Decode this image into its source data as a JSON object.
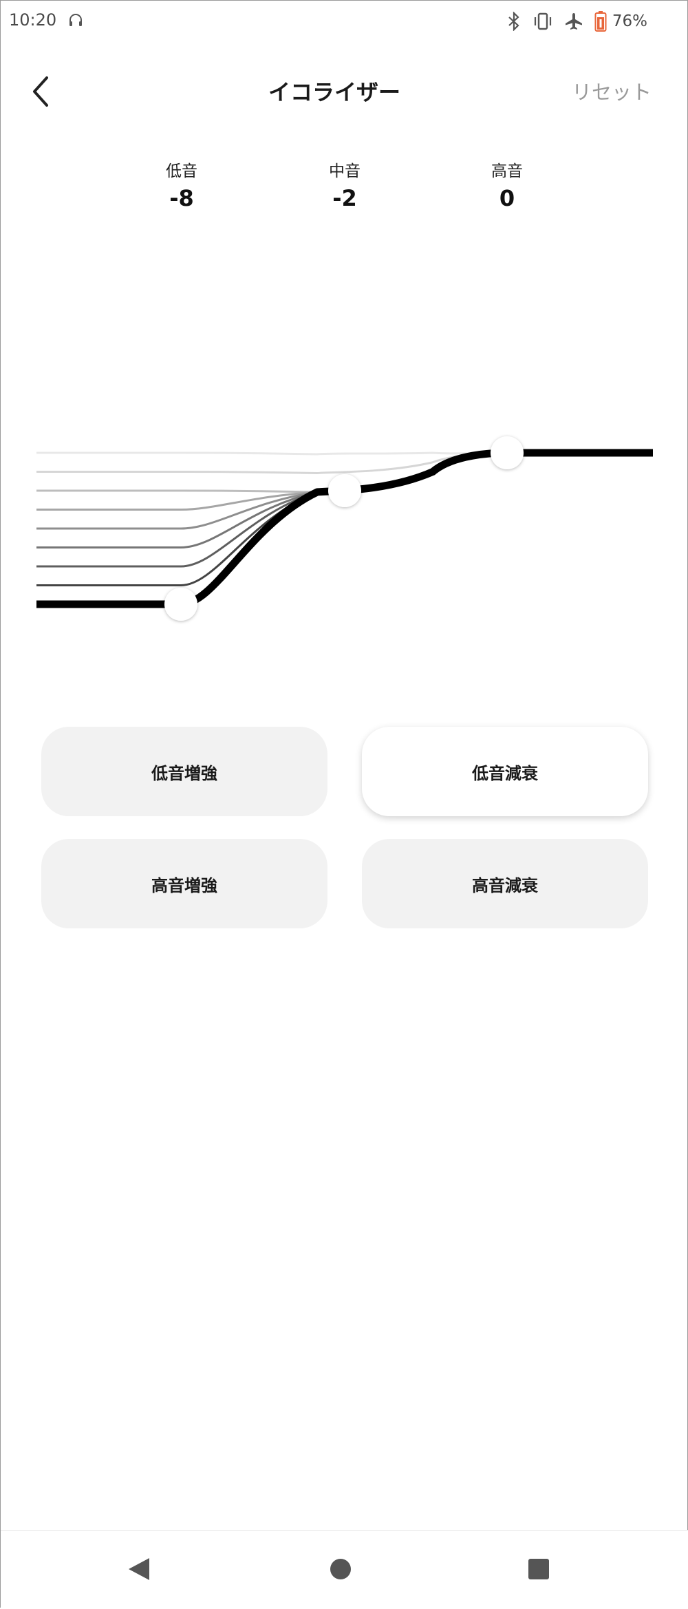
{
  "status_bar": {
    "time": "10:20",
    "battery": "76%",
    "icons": [
      "headphone-icon",
      "bluetooth-icon",
      "vibrate-icon",
      "airplane-icon",
      "battery-icon"
    ],
    "battery_color": "#e8663a"
  },
  "header": {
    "title": "イコライザー",
    "reset_label": "リセット",
    "back_icon": "chevron-left-icon"
  },
  "bands": [
    {
      "label": "低音",
      "value": "-8"
    },
    {
      "label": "中音",
      "value": "-2"
    },
    {
      "label": "高音",
      "value": "0"
    }
  ],
  "eq_levels": {
    "bass": -8,
    "mid": -2,
    "treble": 0
  },
  "presets": [
    {
      "label": "低音増強",
      "selected": false
    },
    {
      "label": "低音減衰",
      "selected": true
    },
    {
      "label": "高音増強",
      "selected": false
    },
    {
      "label": "高音減衰",
      "selected": false
    }
  ],
  "nav": {
    "icons": [
      "back-triangle-icon",
      "home-circle-icon",
      "recents-square-icon"
    ]
  }
}
